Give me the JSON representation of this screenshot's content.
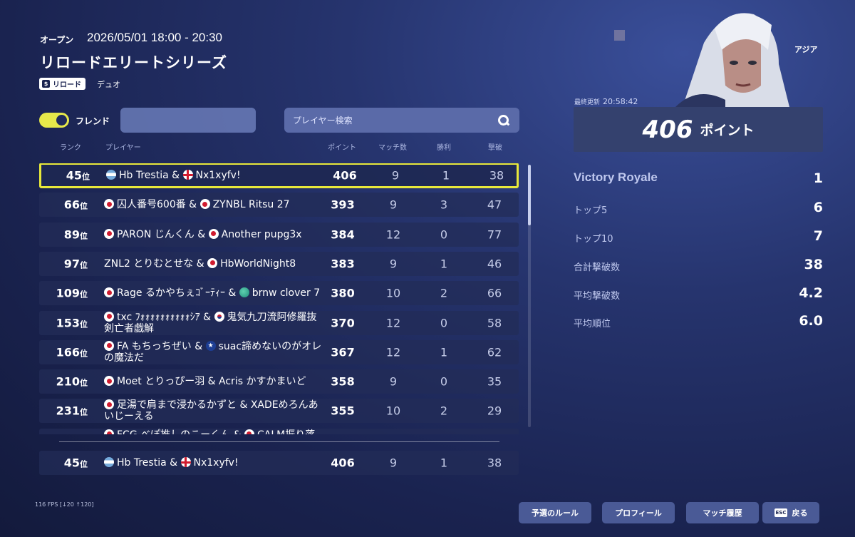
{
  "header": {
    "status": "オープン",
    "time": "2026/05/01 18:00 - 20:30",
    "title": "リロードエリートシリーズ",
    "tag": "リロード",
    "mode": "デュオ"
  },
  "filters": {
    "friends_label": "フレンド",
    "friends_toggle_on": true,
    "search_placeholder": "プレイヤー検索"
  },
  "columns": {
    "rank": "ランク",
    "player": "プレイヤー",
    "points": "ポイント",
    "matches": "マッチ数",
    "wins": "勝利",
    "kills": "撃破"
  },
  "rows": [
    {
      "rank": "45",
      "suffix": "位",
      "p1": "Hb Trestia",
      "f1": "ar",
      "p2": "Nx1xyfv!",
      "f2": "en",
      "points": "406",
      "matches": "9",
      "wins": "1",
      "kills": "38",
      "hl": true
    },
    {
      "rank": "66",
      "suffix": "位",
      "p1": "囚人番号600番",
      "f1": "jp",
      "p2": "ZYNBL Ritsu 27",
      "f2": "jp",
      "points": "393",
      "matches": "9",
      "wins": "3",
      "kills": "47"
    },
    {
      "rank": "89",
      "suffix": "位",
      "p1": "PARON じんくん",
      "f1": "jp",
      "p2": "Another pupg3x",
      "f2": "jp",
      "points": "384",
      "matches": "12",
      "wins": "0",
      "kills": "77"
    },
    {
      "rank": "97",
      "suffix": "位",
      "p1": "ZNL2 とりむとせな",
      "f1": "",
      "p2": "HbWorldNight8",
      "f2": "jp",
      "points": "383",
      "matches": "9",
      "wins": "1",
      "kills": "46"
    },
    {
      "rank": "109",
      "suffix": "位",
      "p1": "Rage るかやちぇｺﾞｰﾃｨｰ",
      "f1": "jp",
      "p2": "brnw clover 7",
      "f2": "globe",
      "points": "380",
      "matches": "10",
      "wins": "2",
      "kills": "66"
    },
    {
      "rank": "153",
      "suffix": "位",
      "p1": "txc ﾌｫｫｫｫｫｫｫｫｫｫｼｱ",
      "f1": "jp",
      "p2": "鬼気九刀流阿修羅抜剣亡者戯解",
      "f2": "kr",
      "points": "370",
      "matches": "12",
      "wins": "0",
      "kills": "58"
    },
    {
      "rank": "166",
      "suffix": "位",
      "p1": "FA もちっちぜい",
      "f1": "jp",
      "p2": "suac諦めないのがオレの魔法だ",
      "f2": "au",
      "points": "367",
      "matches": "12",
      "wins": "1",
      "kills": "62"
    },
    {
      "rank": "210",
      "suffix": "位",
      "p1": "Moet とりっぴー羽",
      "f1": "jp",
      "p2": "Acris かすかまいど",
      "f2": "",
      "points": "358",
      "matches": "9",
      "wins": "0",
      "kills": "35"
    },
    {
      "rank": "231",
      "suffix": "位",
      "p1": "足湯で肩まで浸かるかずと",
      "f1": "jp",
      "p2": "XADEめろんあいじーえる",
      "f2": "",
      "points": "355",
      "matches": "10",
      "wins": "2",
      "kills": "29"
    },
    {
      "rank": "",
      "suffix": "",
      "p1": "FCG べぽ推しのこーくん",
      "f1": "jp",
      "p2": "CALM振り落とされ",
      "f2": "jp",
      "points": "",
      "matches": "",
      "wins": "",
      "kills": ""
    }
  ],
  "my_row": {
    "rank": "45",
    "suffix": "位",
    "p1": "Hb Trestia",
    "f1": "ar",
    "p2": "Nx1xyfv!",
    "f2": "en",
    "points": "406",
    "matches": "9",
    "wins": "1",
    "kills": "38"
  },
  "sidebar": {
    "region": "アジア",
    "updated_label": "最終更新",
    "updated_time": "20:58:42",
    "points_value": "406",
    "points_unit": "ポイント",
    "stats": [
      {
        "label": "Victory Royale",
        "value": "1"
      },
      {
        "label": "トップ5",
        "value": "6"
      },
      {
        "label": "トップ10",
        "value": "7"
      },
      {
        "label": "合計撃破数",
        "value": "38"
      },
      {
        "label": "平均撃破数",
        "value": "4.2"
      },
      {
        "label": "平均順位",
        "value": "6.0"
      }
    ]
  },
  "footer": {
    "fps": "116 FPS [↓20 ↑120]",
    "buttons": [
      "予選のルール",
      "プロフィール",
      "マッチ履歴",
      "戻る"
    ],
    "esc_key": "ESC"
  },
  "colors": {
    "highlight": "#e8e83a",
    "toggle": "#e6e84a"
  }
}
